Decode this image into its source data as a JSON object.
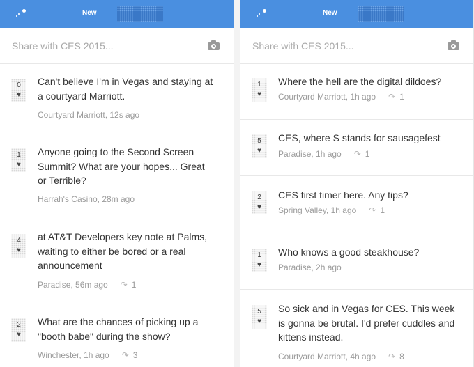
{
  "screens": [
    {
      "header": {
        "tab_new": "New",
        "tab_hot": "Hot"
      },
      "share": {
        "placeholder": "Share with CES 2015..."
      },
      "posts": [
        {
          "votes": "0",
          "lines": [
            "Can't believe I'm in Vegas and staying at",
            "a courtyard Marriott."
          ],
          "meta": "Courtyard Marriott, 12s ago",
          "replies": ""
        },
        {
          "votes": "1",
          "lines": [
            "Anyone going to the Second Screen",
            "Summit? What are your hopes... Great",
            "or Terrible?"
          ],
          "meta": "Harrah's Casino, 28m ago",
          "replies": ""
        },
        {
          "votes": "4",
          "lines": [
            "at AT&T Developers key note at Palms,",
            "waiting to either be bored or a real",
            "announcement"
          ],
          "meta": "Paradise, 56m ago",
          "replies": "1"
        },
        {
          "votes": "2",
          "lines": [
            "What are the chances of picking up a",
            "\"booth babe\" during the show?"
          ],
          "meta": "Winchester, 1h ago",
          "replies": "3"
        }
      ]
    },
    {
      "header": {
        "tab_new": "New",
        "tab_hot": "Hot"
      },
      "share": {
        "placeholder": "Share with CES 2015..."
      },
      "posts": [
        {
          "votes": "1",
          "lines": [
            "Where the hell are the digital dildoes?"
          ],
          "meta": "Courtyard Marriott, 1h ago",
          "replies": "1"
        },
        {
          "votes": "5",
          "lines": [
            "CES, where S stands for sausagefest"
          ],
          "meta": "Paradise, 1h ago",
          "replies": "1"
        },
        {
          "votes": "2",
          "lines": [
            "CES first timer here. Any tips?"
          ],
          "meta": "Spring Valley, 1h ago",
          "replies": "1"
        },
        {
          "votes": "1",
          "lines": [
            "Who knows a good steakhouse?"
          ],
          "meta": "Paradise, 2h ago",
          "replies": ""
        },
        {
          "votes": "5",
          "lines": [
            "So sick and in Vegas for CES. This week",
            "is gonna be brutal. I'd prefer cuddles and",
            "kittens instead."
          ],
          "meta": "Courtyard Marriott, 4h ago",
          "replies": "8"
        }
      ]
    }
  ],
  "icons": {
    "vote": "heart-icon",
    "reply": "reply-arrow-icon",
    "camera": "camera-icon",
    "logo": "app-logo-icon"
  },
  "colors": {
    "header": "#4a8fe0",
    "text": "#333333",
    "meta": "#9b9b9b"
  }
}
